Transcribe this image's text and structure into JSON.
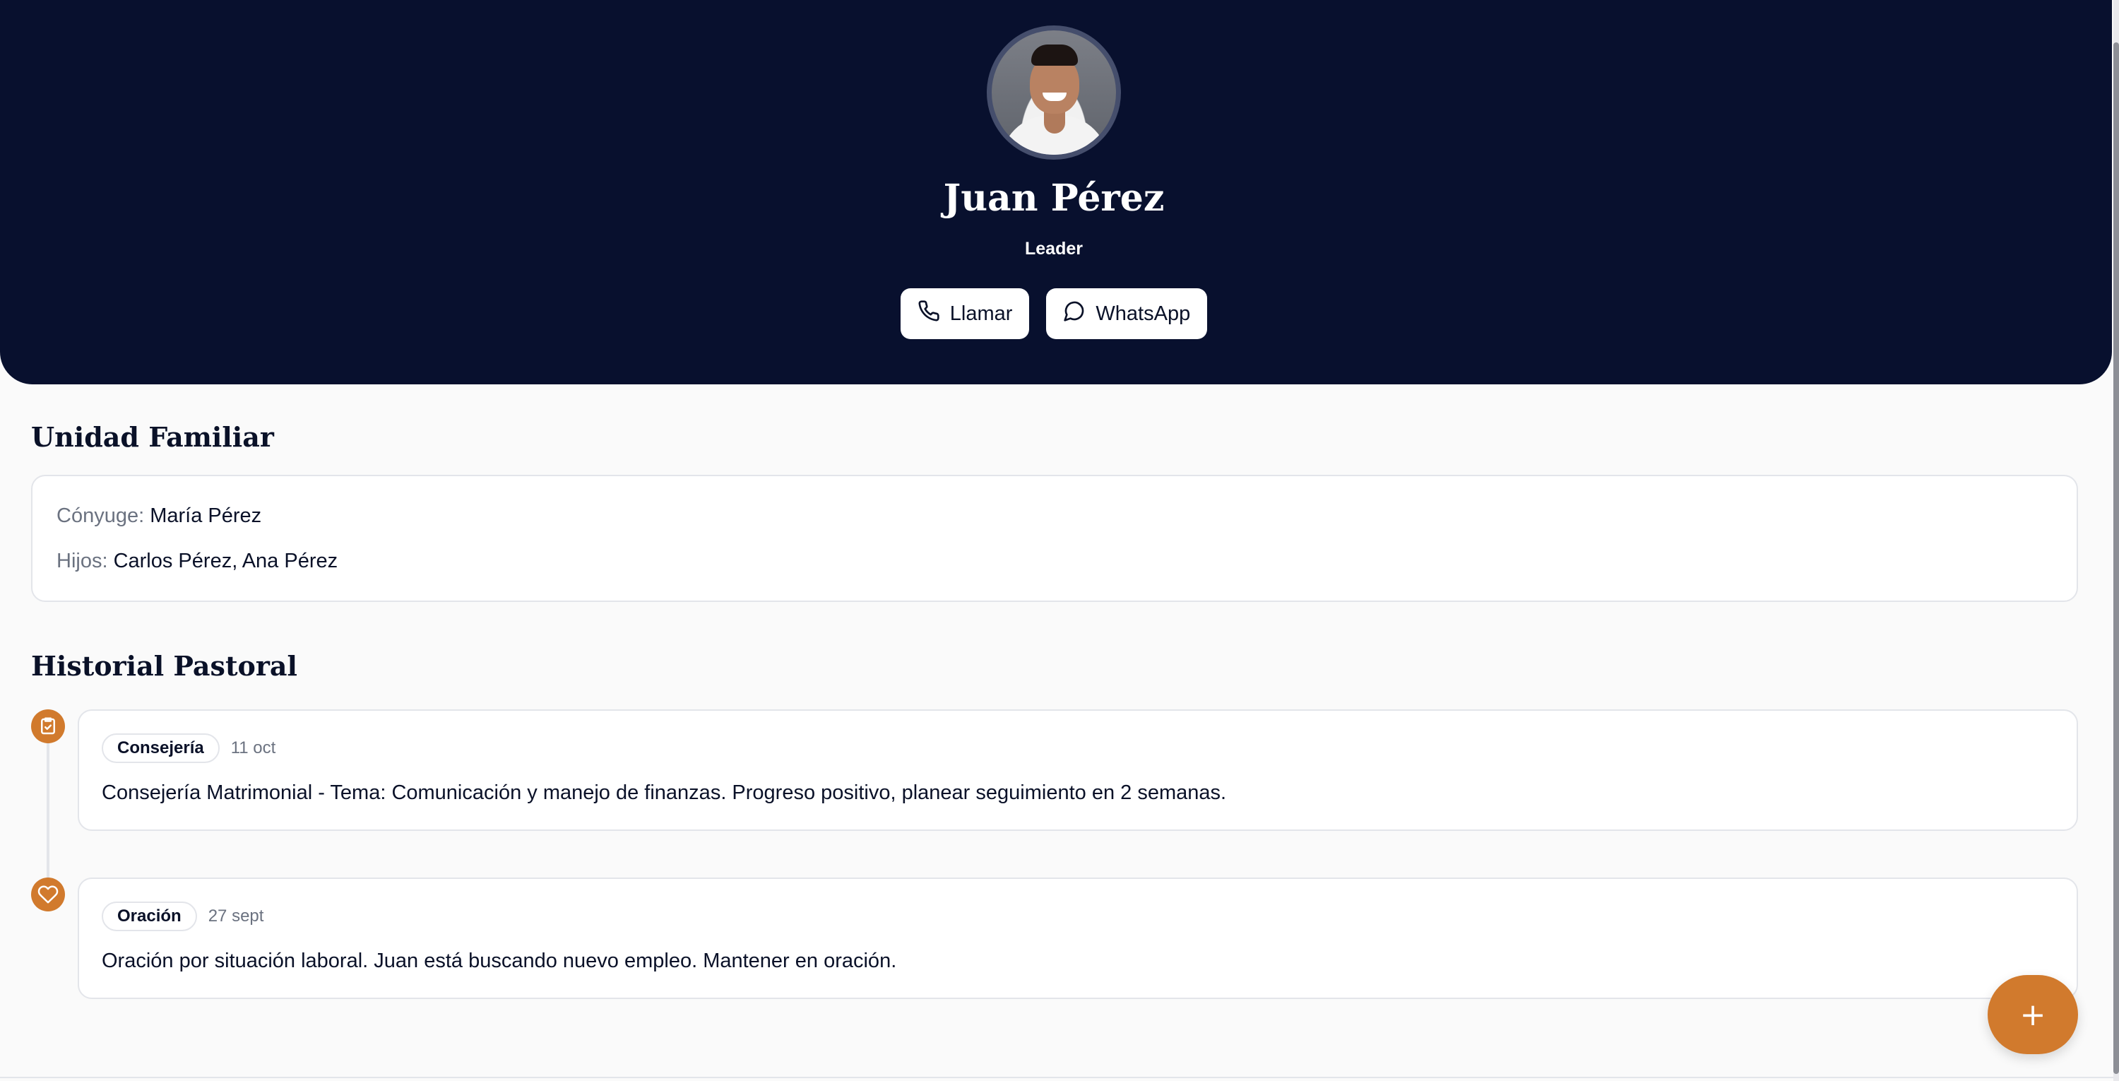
{
  "profile": {
    "name": "Juan Pérez",
    "role": "Leader",
    "call_label": "Llamar",
    "whatsapp_label": "WhatsApp"
  },
  "family": {
    "title": "Unidad Familiar",
    "spouse_label": "Cónyuge:",
    "spouse_value": "María Pérez",
    "children_label": "Hijos:",
    "children_value": "Carlos Pérez, Ana Pérez"
  },
  "history": {
    "title": "Historial Pastoral",
    "entries": [
      {
        "type": "Consejería",
        "date": "11 oct",
        "text": "Consejería Matrimonial - Tema: Comunicación y manejo de finanzas. Progreso positivo, planear seguimiento en 2 semanas.",
        "icon": "counseling-icon"
      },
      {
        "type": "Oración",
        "date": "27 sept",
        "text": "Oración por situación laboral. Juan está buscando nuevo empleo. Mantener en oración.",
        "icon": "heart-icon"
      }
    ]
  },
  "fab": {
    "label": "+"
  },
  "colors": {
    "header_bg": "#08102e",
    "accent": "#d17a2d",
    "page_bg": "#fafafa"
  }
}
